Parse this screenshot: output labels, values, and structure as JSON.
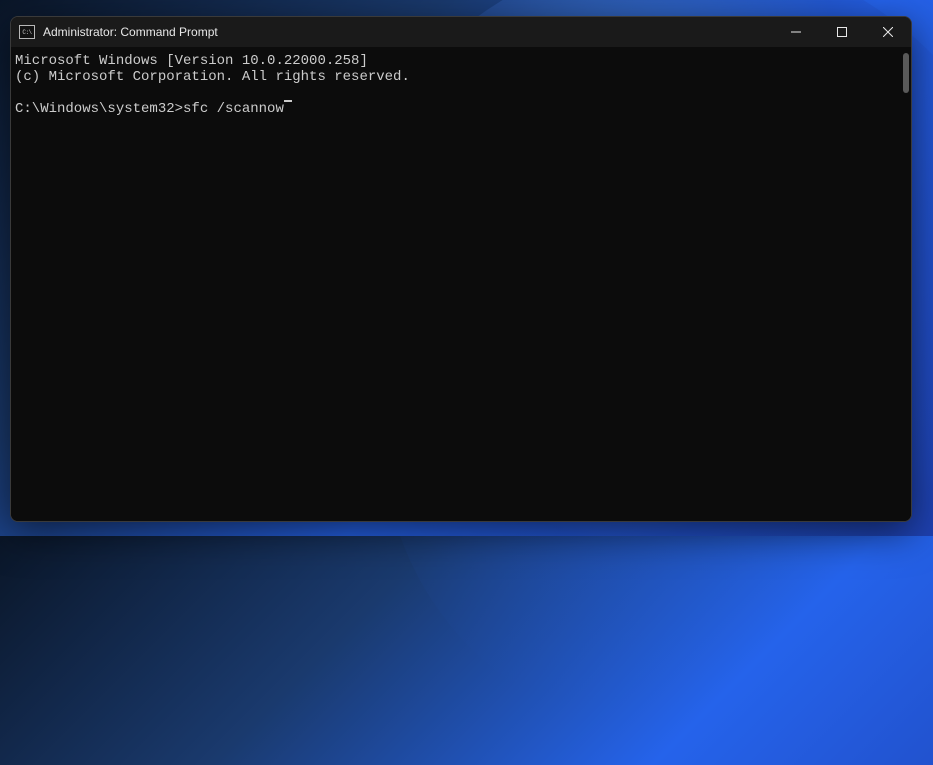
{
  "title_bar": {
    "icon_label": "C:\\",
    "title": "Administrator: Command Prompt"
  },
  "terminal": {
    "banner_line1": "Microsoft Windows [Version 10.0.22000.258]",
    "banner_line2": "(c) Microsoft Corporation. All rights reserved.",
    "prompt": "C:\\Windows\\system32>",
    "command": "sfc /scannow"
  }
}
